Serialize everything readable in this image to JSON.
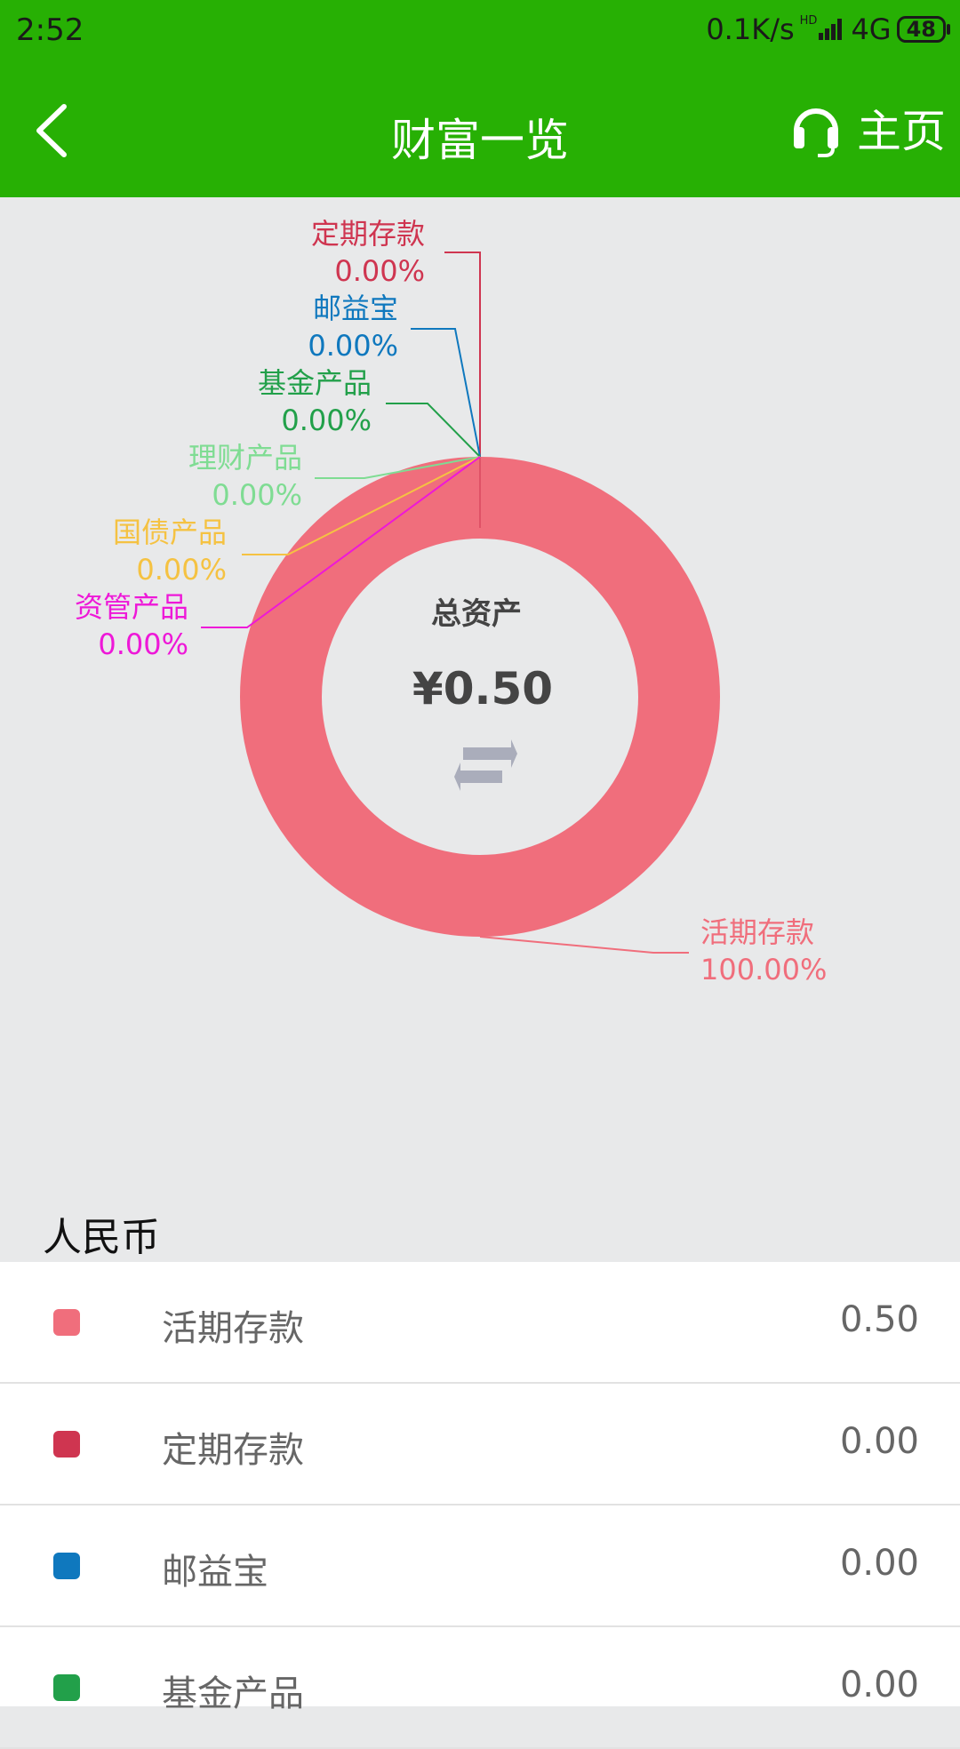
{
  "status": {
    "time": "2:52",
    "network": "0.1K/s",
    "hd": "HD",
    "mobile": "4G",
    "battery": "48"
  },
  "header": {
    "title": "财富一览",
    "home_label": "主页"
  },
  "total": {
    "label": "总资产",
    "amount": "¥0.50"
  },
  "chart_data": {
    "type": "pie",
    "categories": [
      "活期存款",
      "定期存款",
      "邮益宝",
      "基金产品",
      "理财产品",
      "国债产品",
      "资管产品"
    ],
    "values": [
      100.0,
      0.0,
      0.0,
      0.0,
      0.0,
      0.0,
      0.0
    ],
    "labels": [
      "100.00%",
      "0.00%",
      "0.00%",
      "0.00%",
      "0.00%",
      "0.00%",
      "0.00%"
    ],
    "colors": [
      "#f06e7c",
      "#cf3550",
      "#0f78be",
      "#22a04a",
      "#7fdc93",
      "#f5c242",
      "#ee18d8"
    ]
  },
  "section": {
    "title": "人民币"
  },
  "list": [
    {
      "name": "活期存款",
      "value": "0.50",
      "color": "#f06e7c"
    },
    {
      "name": "定期存款",
      "value": "0.00",
      "color": "#cf3550"
    },
    {
      "name": "邮益宝",
      "value": "0.00",
      "color": "#0f78be"
    },
    {
      "name": "基金产品",
      "value": "0.00",
      "color": "#22a04a"
    }
  ]
}
